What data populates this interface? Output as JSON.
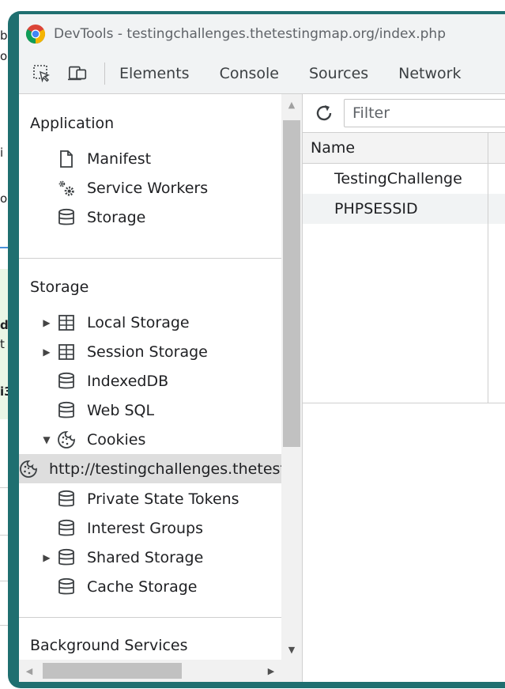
{
  "window": {
    "title": "DevTools - testingchallenges.thetestingmap.org/index.php"
  },
  "tabs": [
    "Elements",
    "Console",
    "Sources",
    "Network"
  ],
  "sidebar": {
    "application": {
      "title": "Application",
      "items": [
        {
          "label": "Manifest",
          "icon": "document-icon"
        },
        {
          "label": "Service Workers",
          "icon": "gears-icon"
        },
        {
          "label": "Storage",
          "icon": "database-icon"
        }
      ]
    },
    "storage": {
      "title": "Storage",
      "items": [
        {
          "label": "Local Storage",
          "icon": "grid-icon",
          "arrow": "▶"
        },
        {
          "label": "Session Storage",
          "icon": "grid-icon",
          "arrow": "▶"
        },
        {
          "label": "IndexedDB",
          "icon": "database-icon"
        },
        {
          "label": "Web SQL",
          "icon": "database-icon"
        },
        {
          "label": "Cookies",
          "icon": "cookie-icon",
          "arrow": "▼"
        },
        {
          "label": "http://testingchallenges.thetestingmap.org",
          "icon": "cookie-icon"
        },
        {
          "label": "Private State Tokens",
          "icon": "database-icon"
        },
        {
          "label": "Interest Groups",
          "icon": "database-icon"
        },
        {
          "label": "Shared Storage",
          "icon": "database-icon",
          "arrow": "▶"
        },
        {
          "label": "Cache Storage",
          "icon": "database-icon"
        }
      ]
    },
    "background": {
      "title": "Background Services"
    }
  },
  "main": {
    "filter_placeholder": "Filter",
    "table": {
      "columns": [
        "Name"
      ],
      "rows": [
        {
          "name": "TestingChallenge"
        },
        {
          "name": "PHPSESSID"
        }
      ]
    }
  },
  "background_page": {
    "fragments": [
      "b",
      "o",
      "i",
      "o",
      "d",
      "t",
      "i3"
    ]
  },
  "colors": {
    "window_frame": "#1f6f70",
    "selected_row": "#dedede",
    "toolbar_bg": "#f1f3f4"
  }
}
